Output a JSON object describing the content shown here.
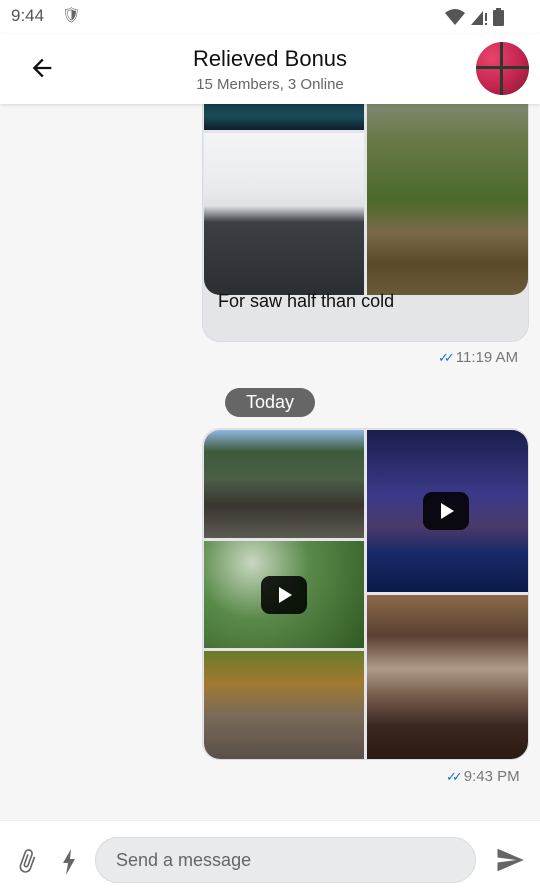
{
  "status_bar": {
    "time": "9:44",
    "s_icon": "S",
    "icons": [
      "wifi-icon",
      "signal-icon",
      "battery-icon"
    ]
  },
  "header": {
    "title": "Relieved Bonus",
    "subtitle": "15 Members, 3 Online",
    "back_icon": "arrow-left-icon",
    "avatar": "group-avatar"
  },
  "messages": [
    {
      "images": [
        "night-sky",
        "snowy-road",
        "forest-river"
      ],
      "caption": "For saw half than cold",
      "time": "11:19 AM",
      "status": "read"
    },
    {
      "date_chip": "Today",
      "images": [
        "mountain-house",
        "city-night-video",
        "grass-video",
        "autumn-stream",
        "book-pages"
      ],
      "time": "9:43 PM",
      "status": "read"
    }
  ],
  "composer": {
    "placeholder": "Send a message",
    "attach_icon": "paperclip-icon",
    "commands_icon": "lightning-icon",
    "send_icon": "send-icon"
  },
  "colors": {
    "accent": "#1e6fd9",
    "bubble": "#e4e5e8",
    "chip": "#666666"
  }
}
